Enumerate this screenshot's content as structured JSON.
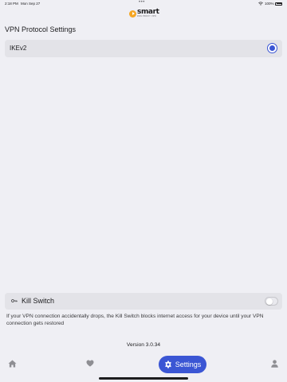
{
  "status_bar": {
    "time": "2:18 PM",
    "date": "Mon Sep 27",
    "multitask_indicator": "•••",
    "battery": "100%",
    "icons": [
      "wifi-icon",
      "battery-icon"
    ]
  },
  "logo": {
    "brand": "smart",
    "tagline": "DNS PROXY VPN"
  },
  "vpn_protocol": {
    "section_title": "VPN Protocol Settings",
    "options": [
      {
        "label": "IKEv2",
        "selected": true
      }
    ]
  },
  "kill_switch": {
    "label": "Kill Switch",
    "enabled": false,
    "description": "If your VPN connection accidentally drops, the Kill Switch blocks internet access for your device until your VPN connection gets restored"
  },
  "version": "Version 3.0.34",
  "tab_bar": {
    "items": [
      {
        "icon": "home-icon",
        "active": false
      },
      {
        "icon": "heart-icon",
        "active": false
      },
      {
        "icon": "gear-icon",
        "label": "Settings",
        "active": true
      },
      {
        "icon": "person-icon",
        "active": false
      }
    ]
  },
  "colors": {
    "accent": "#3b56d4",
    "background": "#efeff4",
    "row_background": "#e3e3e8",
    "logo_orange": "#f5a623"
  }
}
